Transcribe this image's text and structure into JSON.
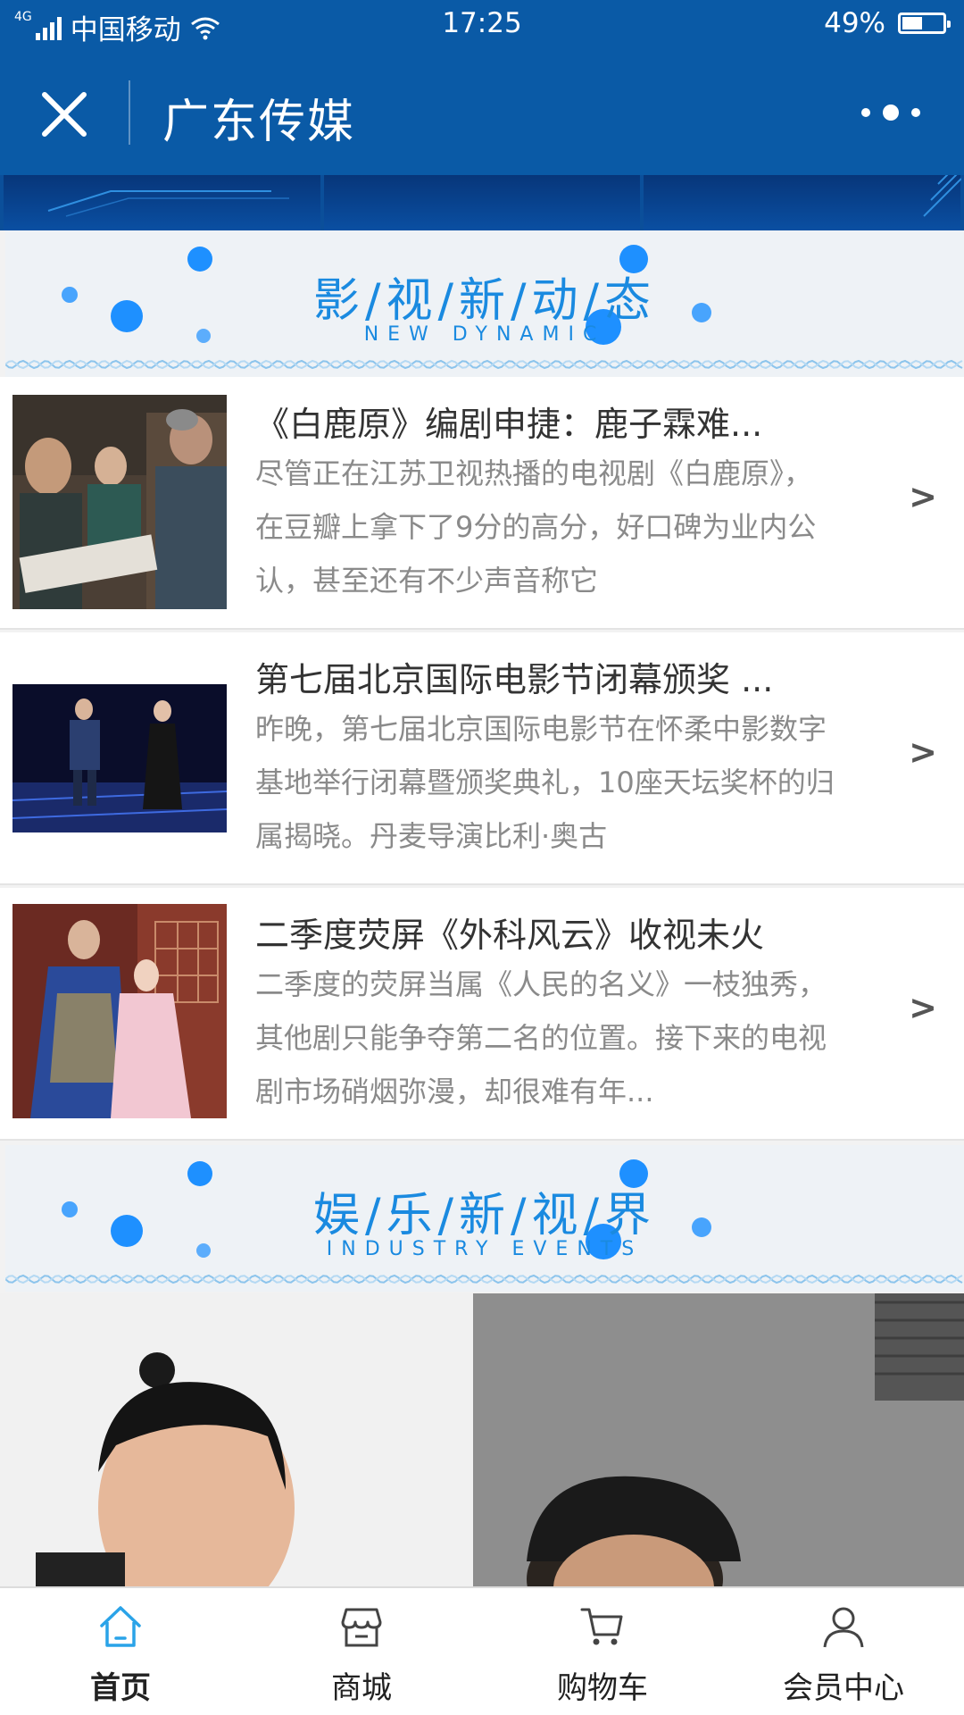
{
  "status_bar": {
    "network": "4G",
    "carrier": "中国移动",
    "time": "17:25",
    "battery": "49%",
    "battery_level": 0.49
  },
  "header": {
    "title": "广东传媒"
  },
  "sections": {
    "film_news": {
      "heading": "影/视/新/动/态",
      "subheading": "NEW DYNAMIC"
    },
    "industry": {
      "heading": "娱/乐/新/视/界",
      "subheading": "INDUSTRY EVENTS"
    }
  },
  "news": [
    {
      "title": "《白鹿原》编剧申捷：鹿子霖难...",
      "summary": "尽管正在江苏卫视热播的电视剧《白鹿原》，在豆瓣上拿下了9分的高分，好口碑为业内公认，甚至还有不少声音称它",
      "arrow": ">"
    },
    {
      "title": "第七届北京国际电影节闭幕颁奖 ...",
      "summary": "昨晚，第七届北京国际电影节在怀柔中影数字基地举行闭幕暨颁奖典礼，10座天坛奖杯的归属揭晓。丹麦导演比利·奥古",
      "arrow": ">"
    },
    {
      "title": "二季度荧屏《外科风云》收视未火",
      "summary": "二季度的荧屏当属《人民的名义》一枝独秀，其他剧只能争夺第二名的位置。接下来的电视剧市场硝烟弥漫，却很难有年...",
      "arrow": ">"
    }
  ],
  "tabbar": {
    "items": [
      {
        "label": "首页",
        "icon": "home-icon",
        "active": true
      },
      {
        "label": "商城",
        "icon": "store-icon",
        "active": false
      },
      {
        "label": "购物车",
        "icon": "cart-icon",
        "active": false
      },
      {
        "label": "会员中心",
        "icon": "user-icon",
        "active": false
      }
    ]
  },
  "colors": {
    "primary": "#0a5aa6",
    "accent": "#1a8ae0",
    "active_tab": "#2aa3e8"
  }
}
